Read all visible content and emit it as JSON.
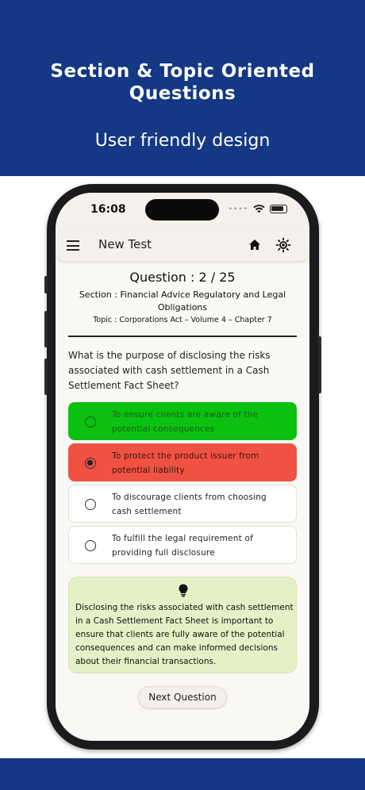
{
  "banner": {
    "headline": "Section & Topic Oriented Questions",
    "subline": "User friendly design"
  },
  "status_bar": {
    "time": "16:08"
  },
  "app_bar": {
    "title": "New Test",
    "icons": [
      "menu-icon",
      "home-icon",
      "brightness-icon"
    ]
  },
  "question": {
    "number_label": "Question : 2 / 25",
    "section": "Section : Financial Advice Regulatory and Legal Obligations",
    "topic": "Topic : Corporations Act – Volume 4 – Chapter 7",
    "text": "What is the purpose of disclosing the risks associated with cash settlement in a Cash Settlement Fact Sheet?"
  },
  "options": [
    {
      "text": "To ensure clients are aware of the potential consequences",
      "state": "correct",
      "color": "#0ac110"
    },
    {
      "text": "To protect the product issuer from potential liability",
      "state": "wrong-selected",
      "color": "#ef5143"
    },
    {
      "text": "To discourage clients from choosing cash settlement",
      "state": "default"
    },
    {
      "text": "To fulfill the legal requirement of providing full disclosure",
      "state": "default"
    }
  ],
  "explanation": {
    "icon": "lightbulb-icon",
    "text": "Disclosing the risks associated with cash settlement in a Cash Settlement Fact Sheet is important to ensure that clients are fully aware of the potential consequences and can make informed decisions about their financial transactions."
  },
  "next_button": {
    "label": "Next Question"
  },
  "colors": {
    "brand_blue": "#143883",
    "hint_bg": "#e5f0c7"
  }
}
